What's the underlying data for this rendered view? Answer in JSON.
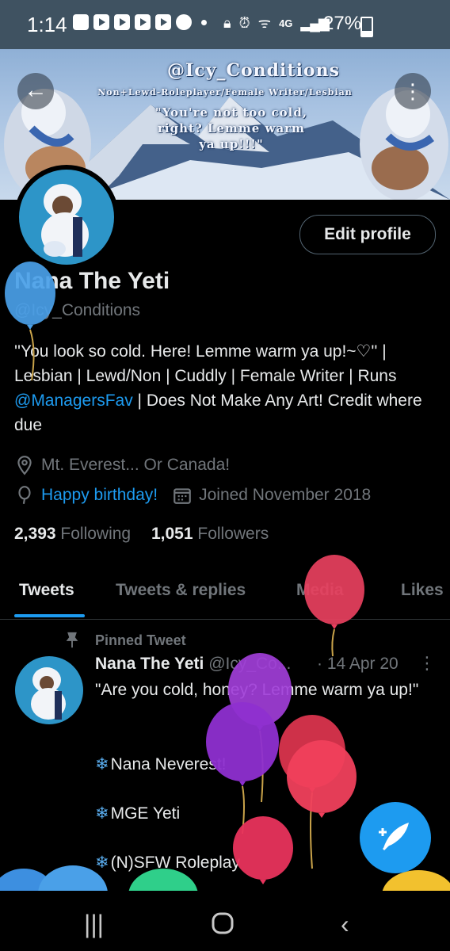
{
  "status_bar": {
    "time": "1:14",
    "network": "4G",
    "battery": "27%"
  },
  "banner": {
    "handle": "@Icy_Conditions",
    "subtitle": "Non+Lewd-Roleplayer/Female Writer/Lesbian",
    "quote_line1": "\"You're not too cold,",
    "quote_line2": "right? Lemme warm",
    "quote_line3": "ya up!!!\""
  },
  "profile": {
    "edit_label": "Edit profile",
    "name": "Nana The Yeti",
    "handle": "@Icy_Conditions",
    "bio_part1": "''You look so cold. Here! Lemme warm ya up!~♡'' | Lesbian | Lewd/Non | Cuddly | Female Writer | Runs ",
    "bio_link": "@ManagersFav",
    "bio_part2": " | Does Not Make Any Art! Credit where due",
    "location": "Mt. Everest... Or Canada!",
    "birthday": "Happy birthday!",
    "joined": "Joined November 2018",
    "following_count": "2,393",
    "following_label": "Following",
    "followers_count": "1,051",
    "followers_label": "Followers"
  },
  "tabs": [
    "Tweets",
    "Tweets & replies",
    "Media",
    "Likes"
  ],
  "pinned_tweet": {
    "pinned_label": "Pinned Tweet",
    "name": "Nana The Yeti",
    "handle": "@Icy_Co...",
    "date": "· 14 Apr 20",
    "text": "\"Are you cold, honey? Lemme warm ya up!\"",
    "line1": "Nana Neverest!",
    "line2": "MGE Yeti",
    "line3": "(N)SFW Roleplay"
  },
  "icons": {
    "back": "arrow-left-icon",
    "more": "more-vertical-icon",
    "location": "location-pin-icon",
    "birthday": "balloon-icon",
    "calendar": "calendar-icon",
    "pin": "pin-icon",
    "compose": "compose-feather-icon",
    "snowflake": "❄"
  },
  "colors": {
    "accent": "#1d9bf0",
    "background": "#000000",
    "status_bar": "#3f5261"
  }
}
